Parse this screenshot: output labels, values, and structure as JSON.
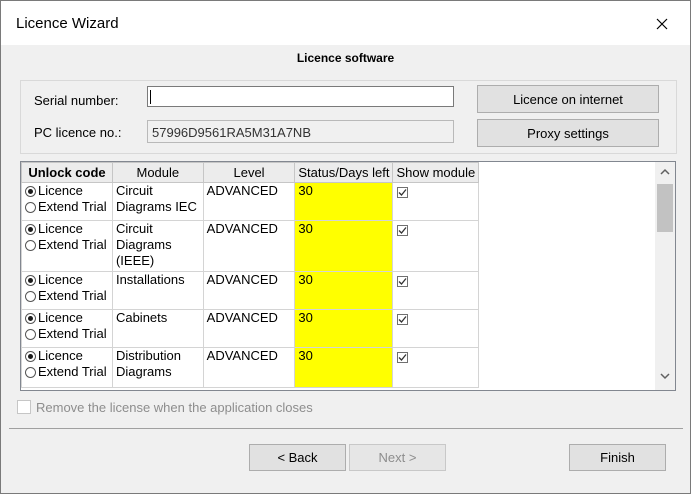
{
  "window": {
    "title": "Licence Wizard"
  },
  "section_title": "Licence software",
  "form": {
    "serial_label": "Serial number:",
    "serial_value": "",
    "pc_label": "PC licence no.:",
    "pc_value": "57996D9561RA5M31A7NB",
    "licence_internet_button": "Licence on internet",
    "proxy_button": "Proxy settings"
  },
  "table": {
    "headers": [
      "Unlock code",
      "Module",
      "Level",
      "Status/Days left",
      "Show module"
    ],
    "rows": [
      {
        "opt1": "Licence",
        "opt2": "Extend Trial",
        "module": "Circuit Diagrams IEC",
        "level": "ADVANCED",
        "status": "30",
        "show": true
      },
      {
        "opt1": "Licence",
        "opt2": "Extend Trial",
        "module": "Circuit Diagrams (IEEE)",
        "level": "ADVANCED",
        "status": "30",
        "show": true
      },
      {
        "opt1": "Licence",
        "opt2": "Extend Trial",
        "module": "Installations",
        "level": "ADVANCED",
        "status": "30",
        "show": true
      },
      {
        "opt1": "Licence",
        "opt2": "Extend Trial",
        "module": "Cabinets",
        "level": "ADVANCED",
        "status": "30",
        "show": true
      },
      {
        "opt1": "Licence",
        "opt2": "Extend Trial",
        "module": "Distribution Diagrams",
        "level": "ADVANCED",
        "status": "30",
        "show": true
      }
    ]
  },
  "remove_license_label": "Remove the license when the application closes",
  "footer": {
    "back_button": "< Back",
    "next_button": "Next >",
    "finish_button": "Finish"
  },
  "colors": {
    "status_highlight": "#ffff00",
    "window_bg": "#f0f0f0"
  }
}
